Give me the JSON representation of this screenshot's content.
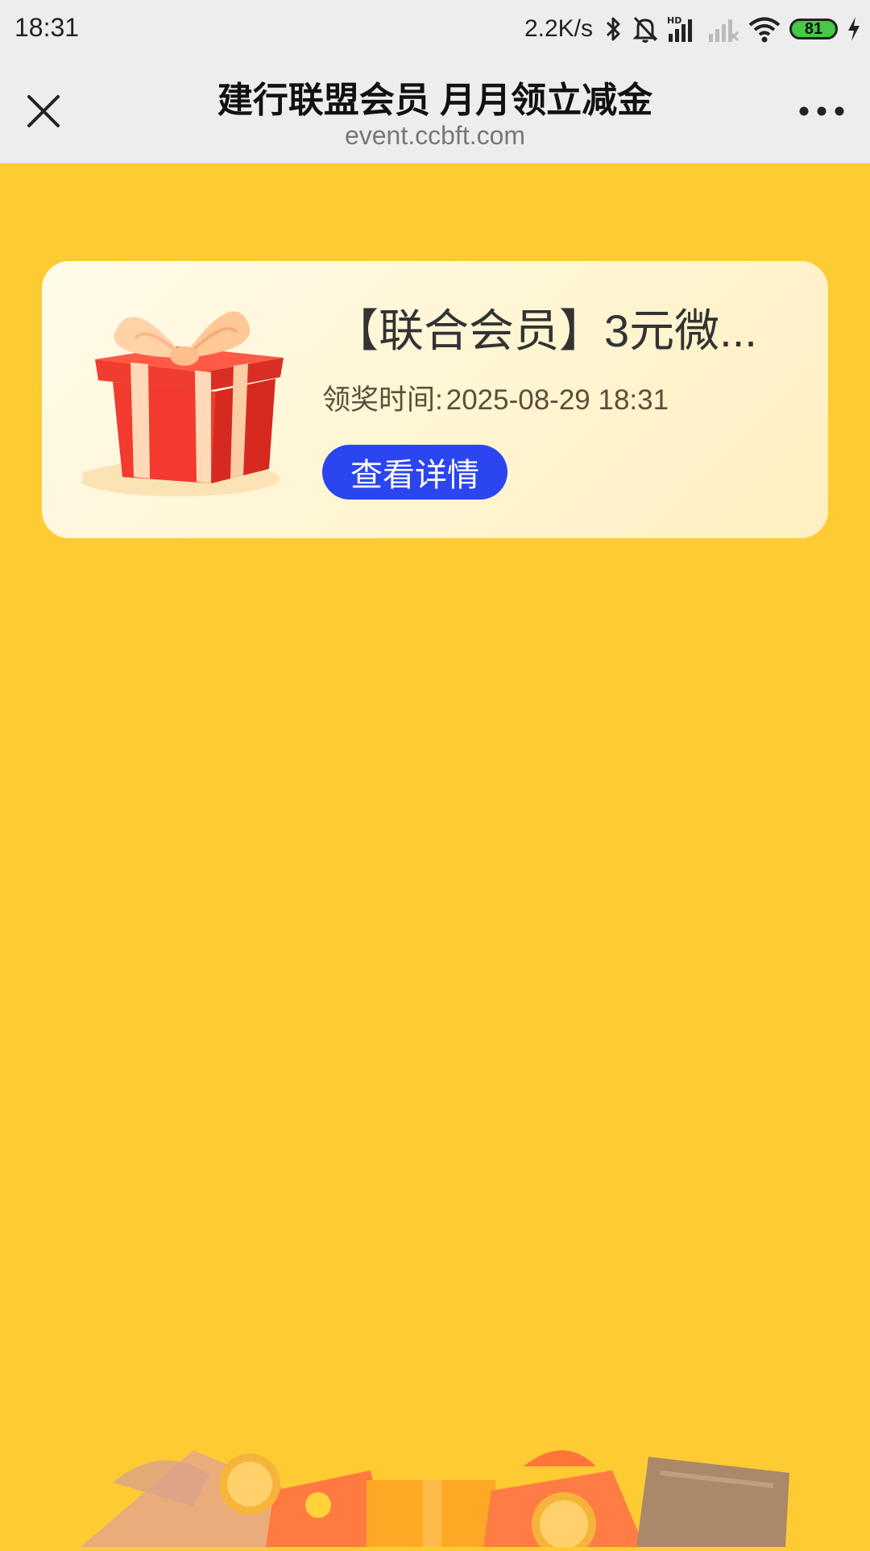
{
  "status_bar": {
    "time": "18:31",
    "net_speed": "2.2K/s",
    "hd_label": "HD",
    "battery": "81",
    "icons": [
      "bluetooth-icon",
      "mute-bell-icon",
      "signal-hd-icon",
      "signal-weak-icon",
      "wifi-icon",
      "battery-icon",
      "charging-icon"
    ]
  },
  "nav": {
    "title": "建行联盟会员 月月领立减金",
    "url": "event.ccbft.com",
    "icons": [
      "close-icon",
      "more-icon"
    ]
  },
  "prize": {
    "title": "【联合会员】3元微...",
    "time_label": "领奖时间:",
    "time_value": "2025-08-29 18:31",
    "button_label": "查看详情"
  },
  "colors": {
    "background": "#FFCB33",
    "card": "#FFF5D2",
    "button": "#2B45F0",
    "battery": "#46C84B"
  }
}
